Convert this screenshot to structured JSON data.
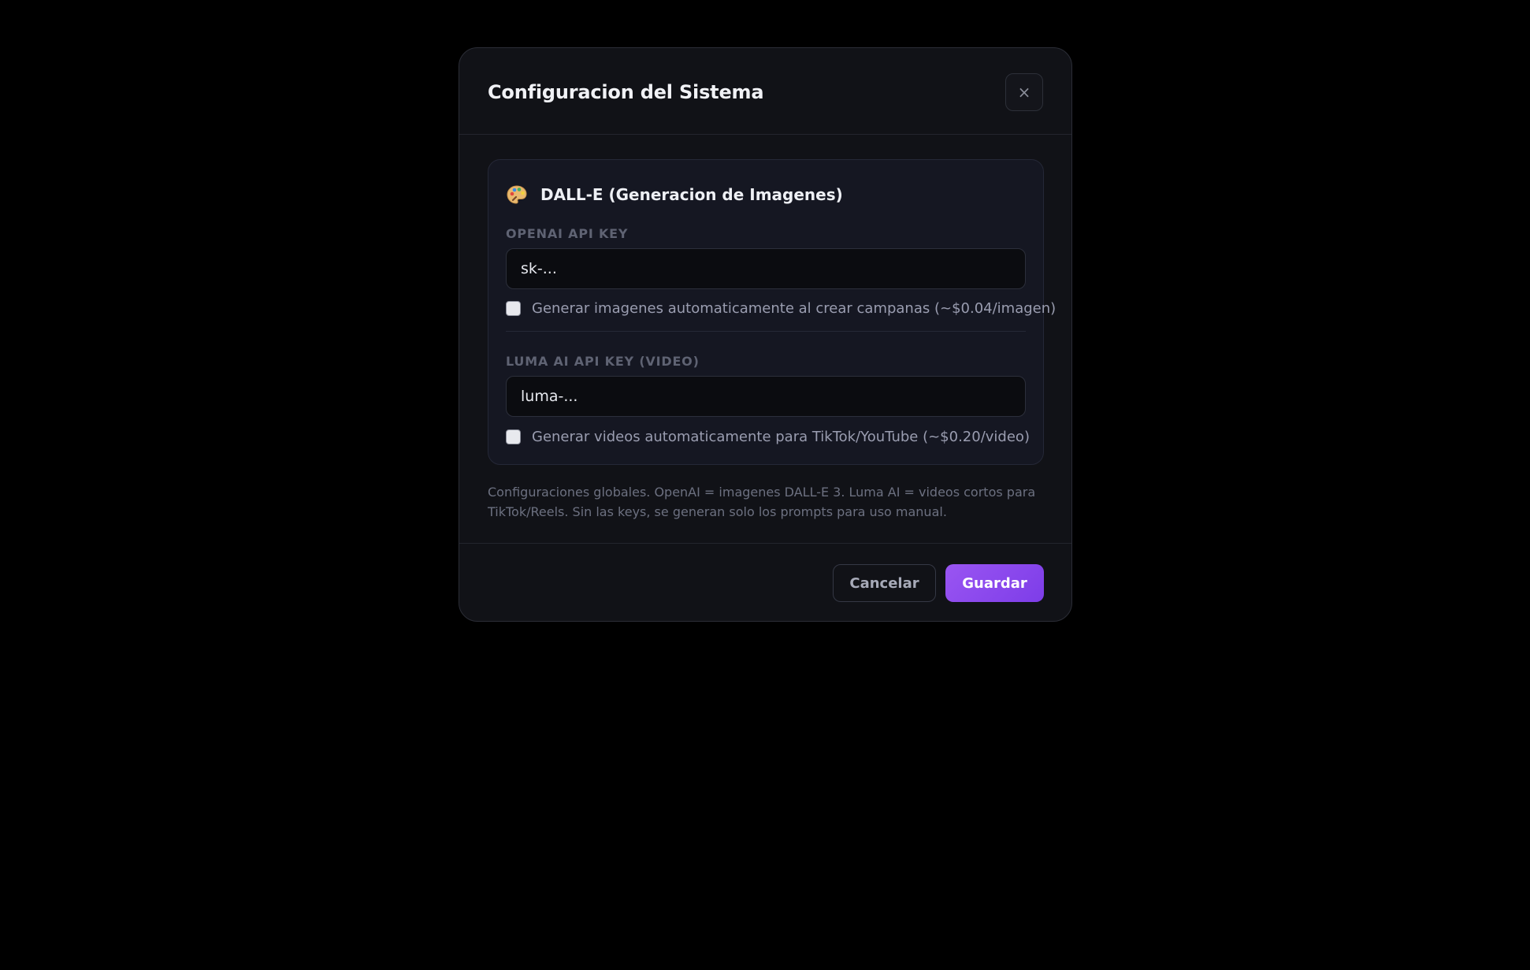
{
  "modal": {
    "title": "Configuracion del Sistema",
    "close_label": "×"
  },
  "dalle_section": {
    "icon": "palette-icon",
    "title": "DALL-E (Generacion de Imagenes)",
    "openai_key_label": "OPENAI API KEY",
    "openai_key_placeholder": "sk-...",
    "openai_key_value": "",
    "auto_images_checked": false,
    "auto_images_label": "Generar imagenes automaticamente al crear campanas (~$0.04/imagen)",
    "luma_key_label": "LUMA AI API KEY (VIDEO)",
    "luma_key_placeholder": "luma-...",
    "luma_key_value": "",
    "auto_videos_checked": false,
    "auto_videos_label": "Generar videos automaticamente para TikTok/YouTube (~$0.20/video)"
  },
  "footnote": "Configuraciones globales. OpenAI = imagenes DALL-E 3. Luma AI = videos cortos para TikTok/Reels. Sin las keys, se generan solo los prompts para uso manual.",
  "footer": {
    "cancel_label": "Cancelar",
    "save_label": "Guardar"
  },
  "colors": {
    "background": "#000000",
    "modal_bg": "#111217",
    "card_bg": "#151722",
    "accent": "#8b4cf0"
  }
}
